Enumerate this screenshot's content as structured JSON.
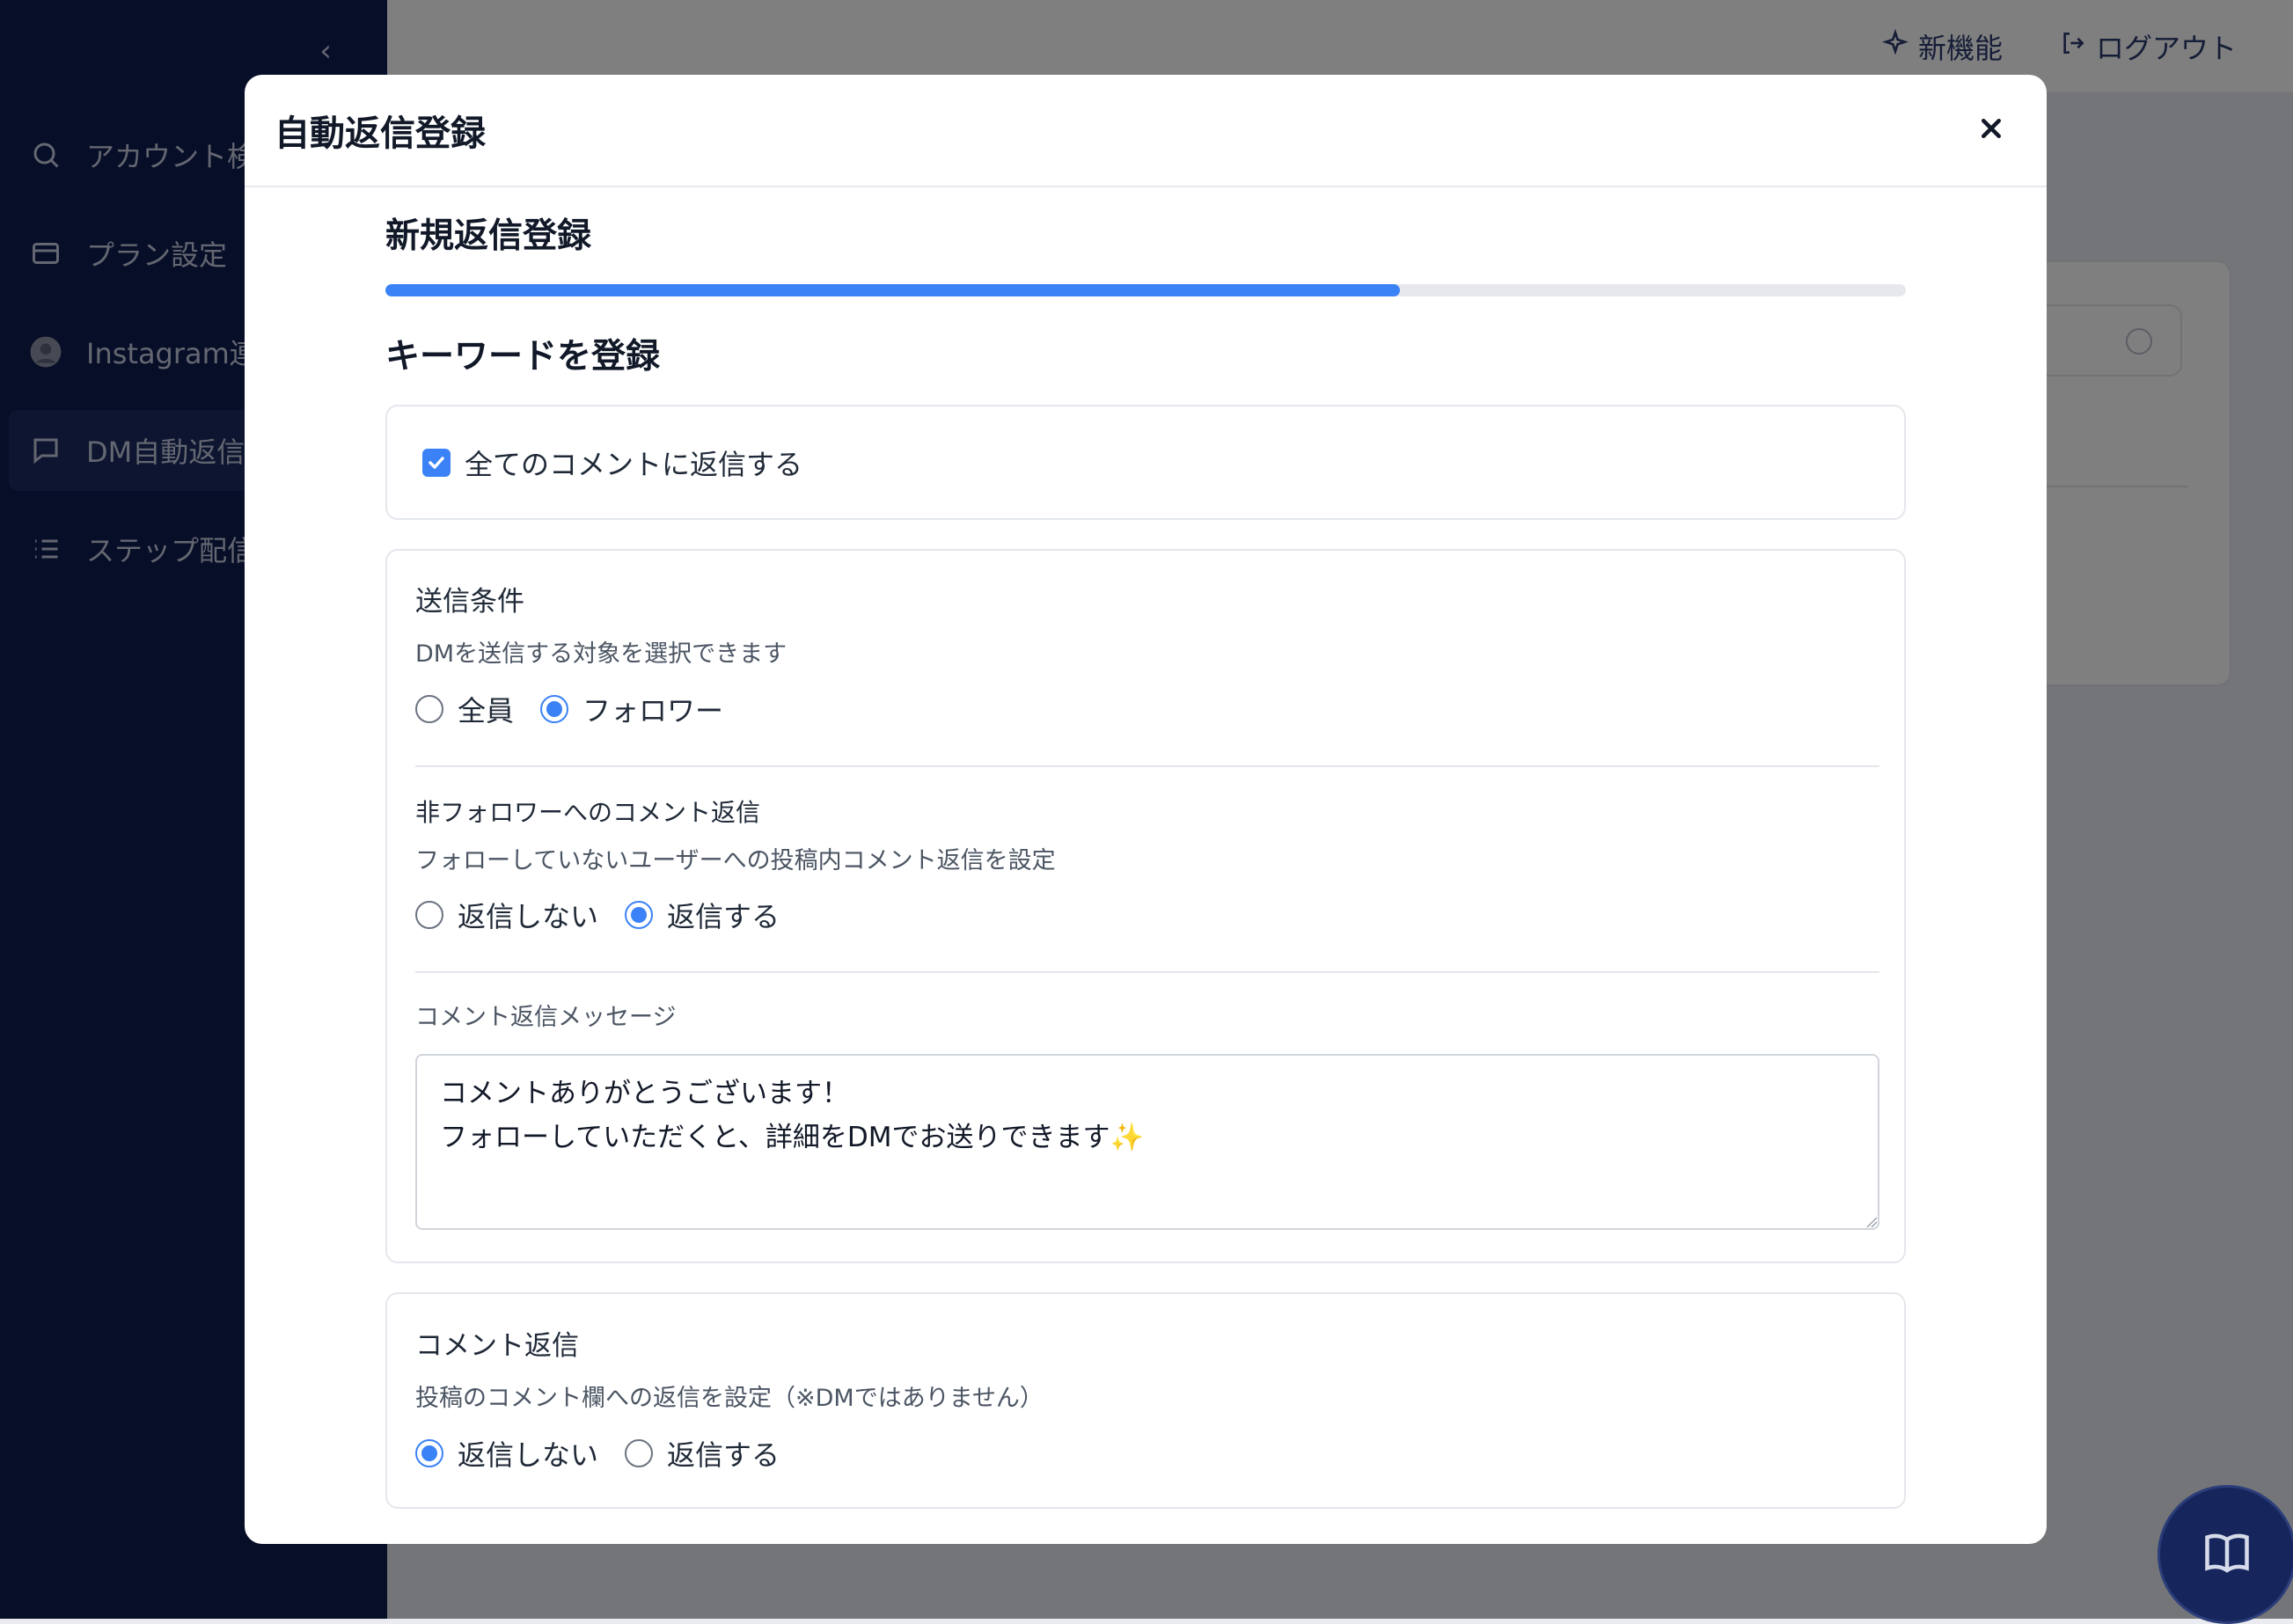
{
  "sidebar": {
    "items": [
      {
        "label": "アカウント検",
        "icon": "search-icon"
      },
      {
        "label": "プラン設定",
        "icon": "card-icon"
      },
      {
        "label": "Instagram連",
        "icon": "avatar-icon"
      },
      {
        "label": "DM自動返信",
        "icon": "chat-icon",
        "active": true
      },
      {
        "label": "ステップ配信",
        "icon": "list-icon"
      }
    ]
  },
  "topbar": {
    "new_features": "新機能",
    "logout": "ログアウト"
  },
  "modal": {
    "title": "自動返信登録",
    "step_title": "新規返信登録",
    "progress_percent": 66.7,
    "section_title": "キーワードを登録",
    "all_comments": {
      "label": "全てのコメントに返信する",
      "checked": true
    },
    "send_condition": {
      "title": "送信条件",
      "description": "DMを送信する対象を選択できます",
      "options": [
        "全員",
        "フォロワー"
      ],
      "selected": "フォロワー"
    },
    "non_follower": {
      "title": "非フォロワーへのコメント返信",
      "description": "フォローしていないユーザーへの投稿内コメント返信を設定",
      "options": [
        "返信しない",
        "返信する"
      ],
      "selected": "返信する"
    },
    "comment_message": {
      "label": "コメント返信メッセージ",
      "value": "コメントありがとうございます！\nフォローしていただくと、詳細をDMでお送りできます✨"
    },
    "comment_reply": {
      "title": "コメント返信",
      "description": "投稿のコメント欄への返信を設定（※DMではありません）",
      "options": [
        "返信しない",
        "返信する"
      ],
      "selected": "返信しない"
    }
  },
  "colors": {
    "accent": "#3b82f6",
    "sidebar": "#0f1d4f"
  }
}
